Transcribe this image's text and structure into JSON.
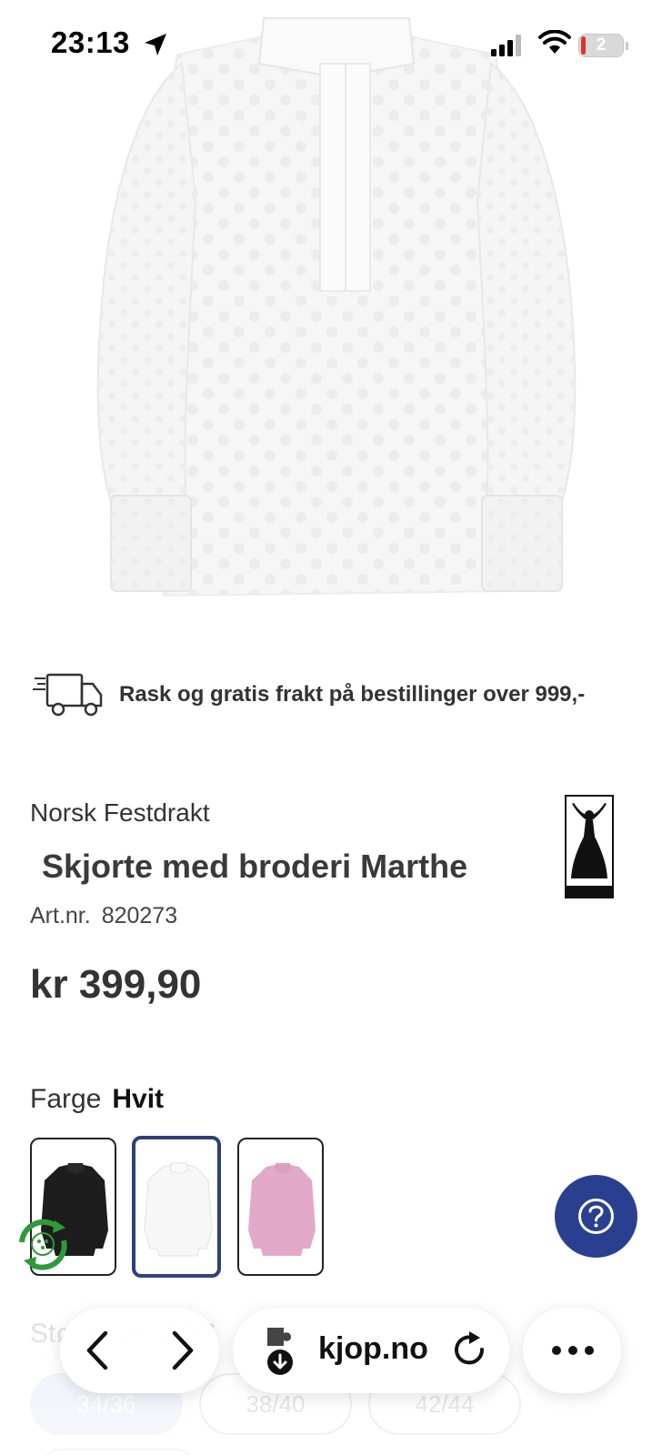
{
  "status_bar": {
    "time": "23:13",
    "battery_level": "2"
  },
  "shipping": {
    "text": "Rask og gratis frakt på bestillinger over 999,-"
  },
  "product": {
    "brand": "Norsk Festdrakt",
    "title": "Skjorte med broderi Marthe",
    "art_label": "Art.nr.",
    "art_number": "820273",
    "price": "kr 399,90"
  },
  "color": {
    "label": "Farge",
    "selected": "Hvit",
    "swatches": [
      "black",
      "white",
      "pink"
    ],
    "selected_index": 1,
    "accent": "#2e3f7a"
  },
  "size": {
    "label": "Størrelse 34/36",
    "options": [
      "34/36",
      "38/40",
      "42/44"
    ],
    "selected": "34/36"
  },
  "browser": {
    "domain_visible": "kjop.no",
    "icons": [
      "chevron-left-icon",
      "chevron-right-icon",
      "extension-icon",
      "reload-icon",
      "more-icon"
    ]
  },
  "colors": {
    "help_button": "#2b3f91",
    "text": "#333333",
    "recycle_green": "#2e9a3a"
  }
}
